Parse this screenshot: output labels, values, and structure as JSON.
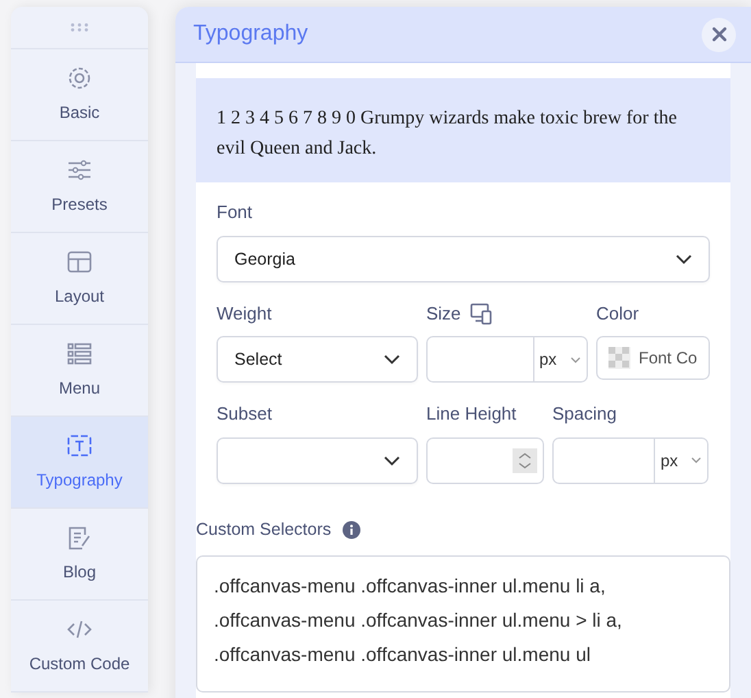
{
  "sidebar": {
    "items": [
      {
        "label": "Basic",
        "selected": false
      },
      {
        "label": "Presets",
        "selected": false
      },
      {
        "label": "Layout",
        "selected": false
      },
      {
        "label": "Menu",
        "selected": false
      },
      {
        "label": "Typography",
        "selected": true
      },
      {
        "label": "Blog",
        "selected": false
      },
      {
        "label": "Custom Code",
        "selected": false
      }
    ]
  },
  "panel": {
    "title": "Typography",
    "preview": "1 2 3 4 5 6 7 8 9 0 Grumpy wizards make toxic brew for the evil Queen and Jack.",
    "font": {
      "label": "Font",
      "value": "Georgia"
    },
    "weight": {
      "label": "Weight",
      "value": "Select"
    },
    "size": {
      "label": "Size",
      "unit": "px"
    },
    "color": {
      "label": "Color",
      "value": "Font Co"
    },
    "subset": {
      "label": "Subset"
    },
    "line_height": {
      "label": "Line Height"
    },
    "spacing": {
      "label": "Spacing",
      "unit": "px"
    },
    "custom_selectors": {
      "label": "Custom Selectors",
      "value": ".offcanvas-menu .offcanvas-inner ul.menu li a,\n.offcanvas-menu .offcanvas-inner ul.menu > li a,\n.offcanvas-menu .offcanvas-inner ul.menu ul"
    }
  }
}
